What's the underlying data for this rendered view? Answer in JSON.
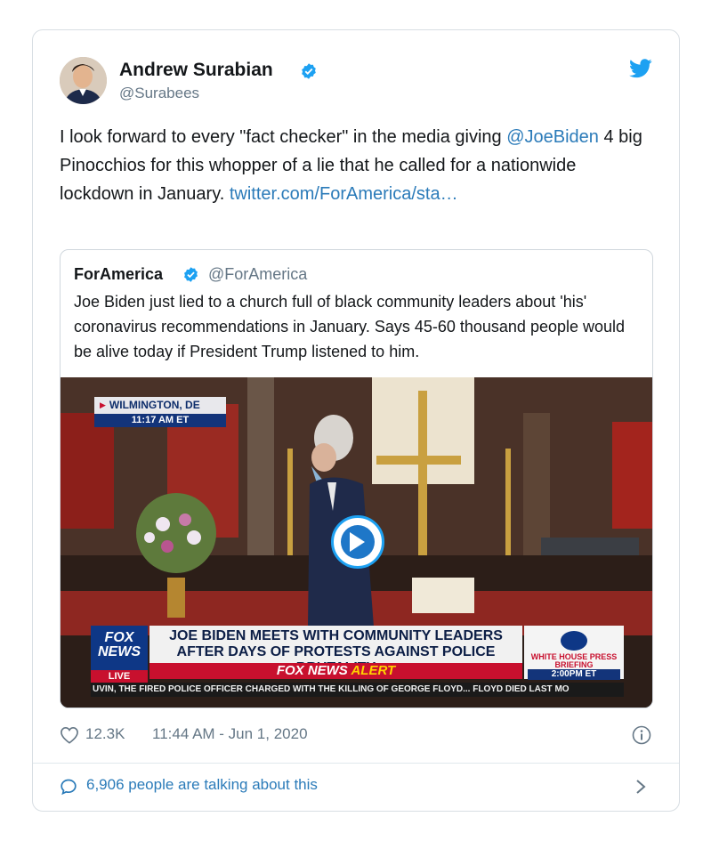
{
  "author": {
    "name": "Andrew Surabian",
    "handle": "@Surabees"
  },
  "tweet": {
    "text_before": "I look forward to every \"fact checker\" in the media giving ",
    "mention": "@JoeBiden",
    "text_after": " 4 big Pinocchios for this whopper of a lie that he called for a nationwide lockdown in January. ",
    "link": "twitter.com/ForAmerica/sta…"
  },
  "quoted": {
    "name": "ForAmerica",
    "handle": "@ForAmerica",
    "text": "Joe Biden just lied to a church full of black community leaders about 'his' coronavirus recommendations in January. Says 45-60 thousand people would be alive today if President Trump listened to him."
  },
  "video": {
    "location": "WILMINGTON, DE",
    "time": "11:17 AM ET",
    "network": "FOX NEWS",
    "live": "LIVE",
    "headline_1": "JOE BIDEN MEETS WITH COMMUNITY LEADERS",
    "headline_2": "AFTER DAYS OF PROTESTS AGAINST POLICE BRUTALITY",
    "alert_brand": "FOX NEWS",
    "alert_word": "ALERT",
    "wh_title": "WHITE HOUSE PRESS BRIEFING",
    "wh_time": "2:00PM ET",
    "ticker": "UVIN, THE FIRED POLICE OFFICER CHARGED WITH THE KILLING OF GEORGE FLOYD...   FLOYD DIED LAST MO"
  },
  "meta": {
    "likes": "12.3K",
    "timestamp": "11:44 AM - Jun 1, 2020"
  },
  "conversation": {
    "label": "6,906 people are talking about this"
  },
  "colors": {
    "link": "#2b7bb9",
    "verified": "#1da1f2",
    "muted": "#657786"
  }
}
